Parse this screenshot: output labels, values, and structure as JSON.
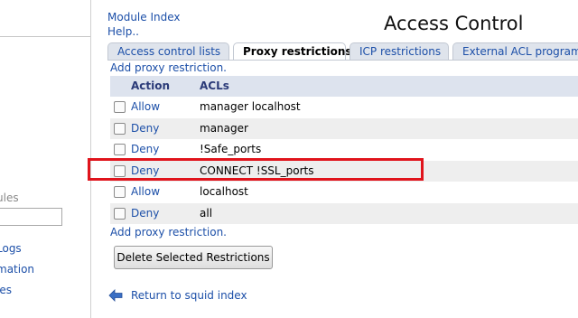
{
  "sidebar": {
    "section_label": "ules",
    "links": [
      "Logs",
      "mation",
      "ies"
    ]
  },
  "header": {
    "module_index": "Module Index",
    "help": "Help..",
    "title": "Access Control"
  },
  "tabs": [
    {
      "label": "Access control lists",
      "active": false
    },
    {
      "label": "Proxy restrictions",
      "active": true
    },
    {
      "label": "ICP restrictions",
      "active": false
    },
    {
      "label": "External ACL programs",
      "active": false
    }
  ],
  "add_link": "Add proxy restriction.",
  "table": {
    "headers": {
      "action": "Action",
      "acls": "ACLs"
    },
    "rows": [
      {
        "action": "Allow",
        "acls": "manager localhost",
        "checked": false
      },
      {
        "action": "Deny",
        "acls": "manager",
        "checked": false
      },
      {
        "action": "Deny",
        "acls": "!Safe_ports",
        "checked": false
      },
      {
        "action": "Deny",
        "acls": "CONNECT !SSL_ports",
        "checked": false
      },
      {
        "action": "Allow",
        "acls": "localhost",
        "checked": false
      },
      {
        "action": "Deny",
        "acls": "all",
        "checked": false
      }
    ]
  },
  "delete_button": "Delete Selected Restrictions",
  "return_link": "Return to squid index",
  "colors": {
    "link": "#1c4fa8",
    "highlight": "#e0141c",
    "header_bg": "#dde3ee"
  }
}
